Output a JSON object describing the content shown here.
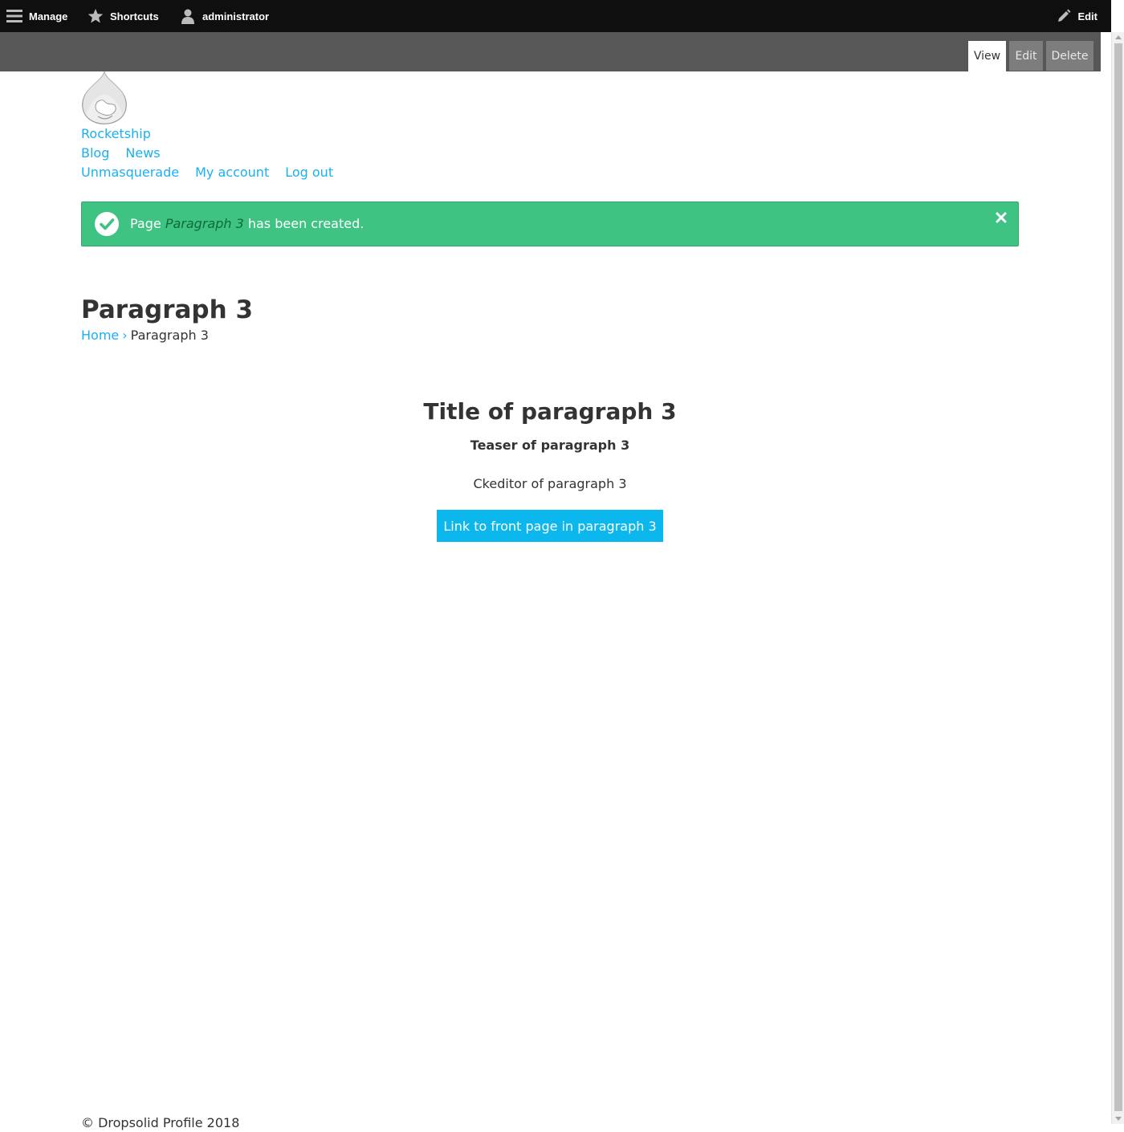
{
  "toolbar": {
    "manage_label": "Manage",
    "shortcuts_label": "Shortcuts",
    "user_label": "administrator",
    "edit_label": "Edit"
  },
  "tabs": [
    {
      "label": "View",
      "active": true
    },
    {
      "label": "Edit",
      "active": false
    },
    {
      "label": "Delete",
      "active": false
    }
  ],
  "site": {
    "name": "Rocketship"
  },
  "main_menu": [
    "Blog",
    "News"
  ],
  "account_menu": [
    "Unmasquerade",
    "My account",
    "Log out"
  ],
  "status": {
    "prefix": "Page",
    "node_title": "Paragraph 3",
    "suffix": "has been created."
  },
  "page": {
    "title": "Paragraph 3",
    "breadcrumb_home": "Home",
    "breadcrumb_separator": "›",
    "breadcrumb_current": "Paragraph 3"
  },
  "paragraph": {
    "title": "Title of paragraph 3",
    "teaser": "Teaser of paragraph 3",
    "body": "Ckeditor of paragraph 3",
    "link_label": "Link to front page in paragraph 3"
  },
  "footer": {
    "text": "© Dropsolid Profile 2018"
  },
  "colors": {
    "toolbar_bg": "#0f0f0f",
    "tasks_bg": "#575757",
    "link": "#1ab0f0",
    "status_bg": "#3fc383",
    "button_bg": "#0cb7ee"
  },
  "icons": {
    "manage": "hamburger-icon",
    "shortcuts": "star-icon",
    "user": "user-icon",
    "edit": "pencil-icon",
    "status": "checkmark-icon",
    "close": "close-icon",
    "logo": "drupal-drop-logo"
  }
}
